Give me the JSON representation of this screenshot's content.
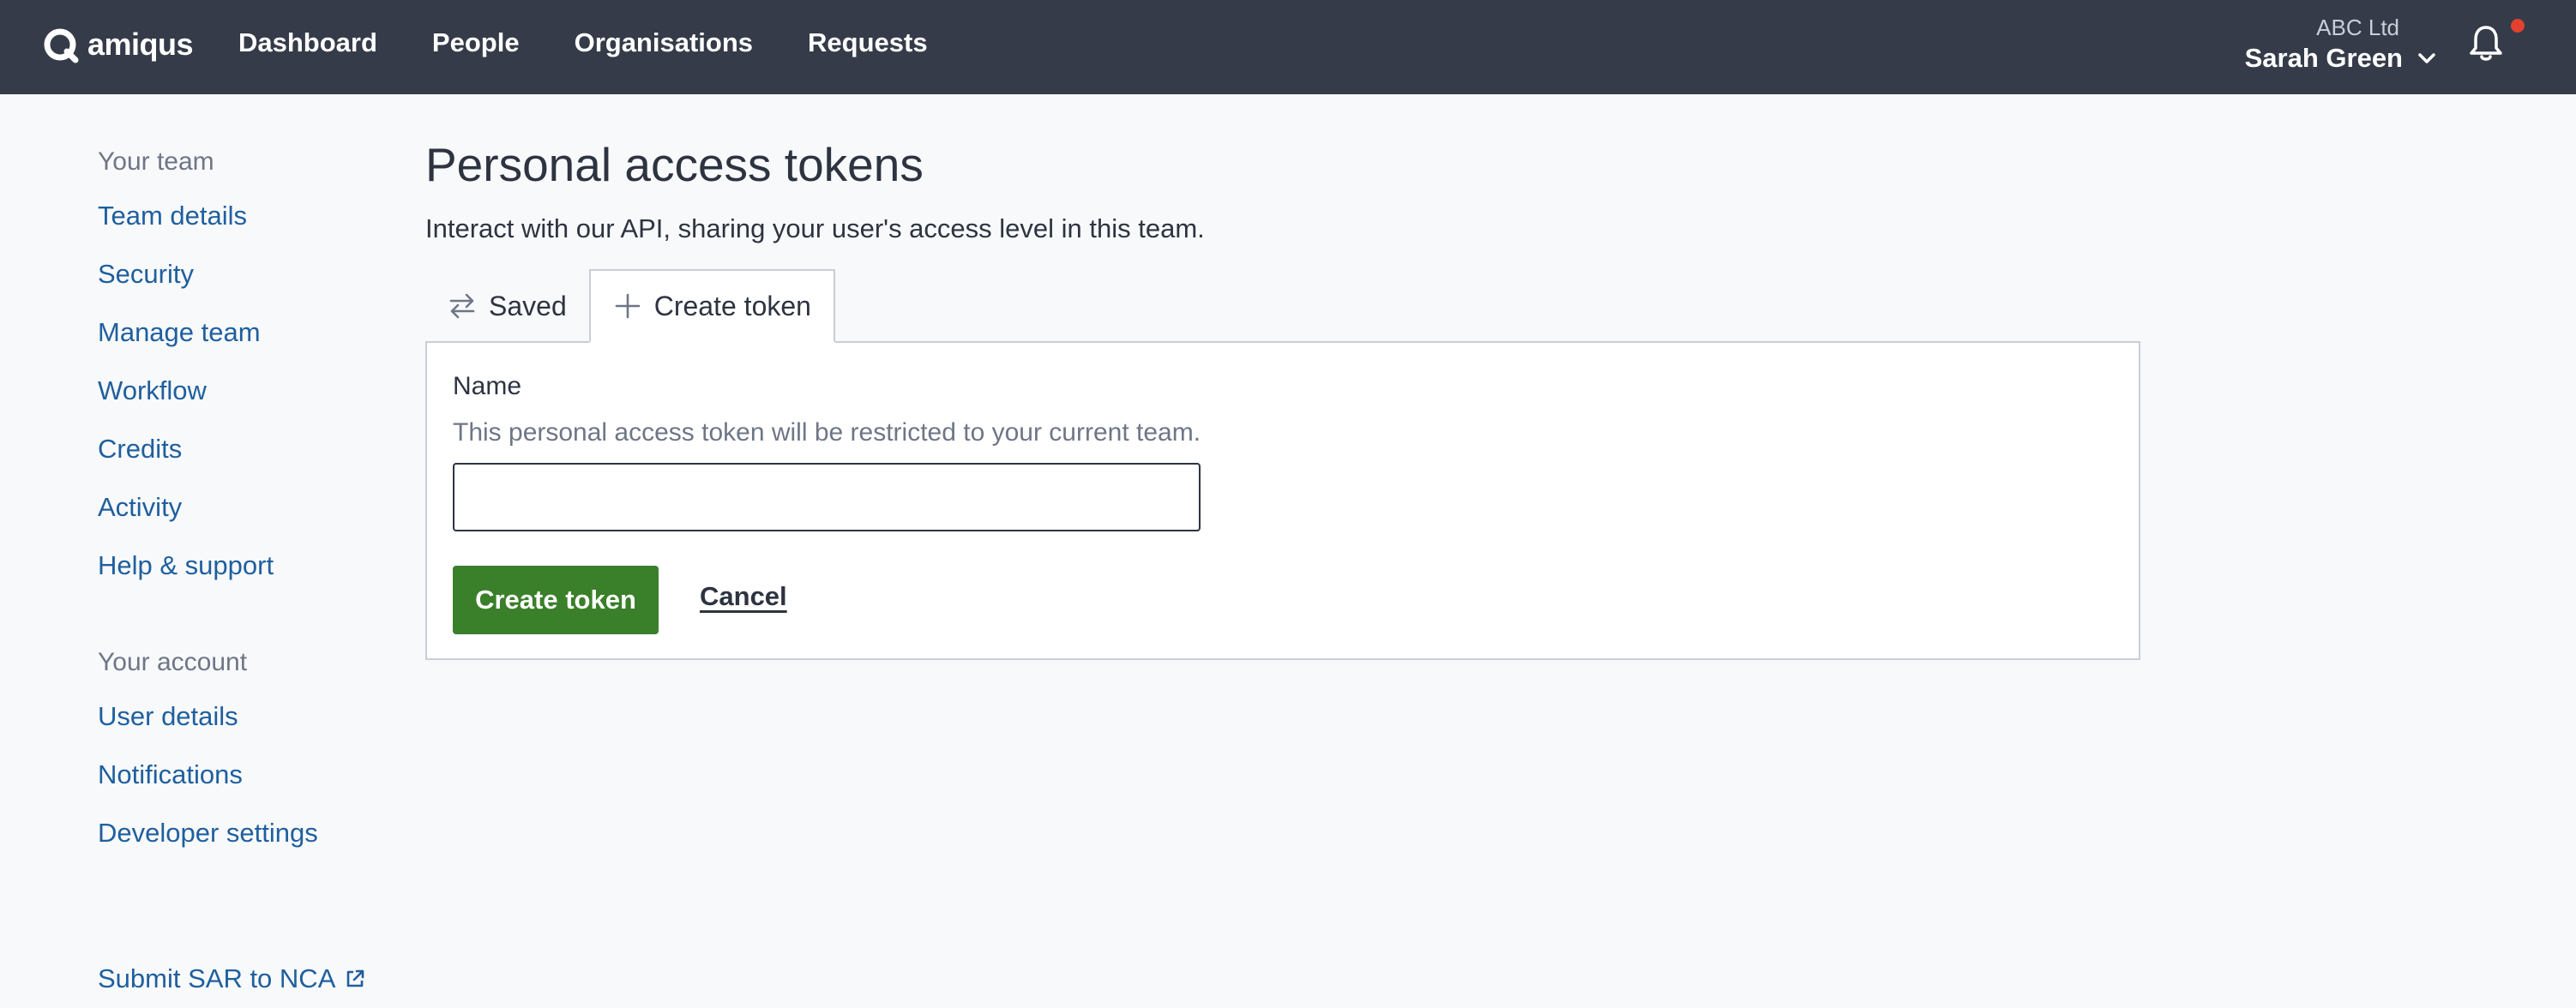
{
  "brand": {
    "name": "amiqus",
    "accent": "#3a7f29",
    "navbar_bg": "#353b48",
    "link_color": "#1f5f9e",
    "notification_color": "#e2412f"
  },
  "nav": {
    "items": [
      {
        "label": "Dashboard"
      },
      {
        "label": "People"
      },
      {
        "label": "Organisations"
      },
      {
        "label": "Requests"
      }
    ]
  },
  "account": {
    "organisation": "ABC Ltd",
    "user": "Sarah Green",
    "menu_icon": "chevron-down-icon",
    "notifications_icon": "bell-icon",
    "has_unread": true
  },
  "sidebar": {
    "team_heading": "Your team",
    "team_links": [
      {
        "label": "Team details"
      },
      {
        "label": "Security"
      },
      {
        "label": "Manage team"
      },
      {
        "label": "Workflow"
      },
      {
        "label": "Credits"
      },
      {
        "label": "Activity"
      },
      {
        "label": "Help & support"
      }
    ],
    "account_heading": "Your account",
    "account_links": [
      {
        "label": "User details"
      },
      {
        "label": "Notifications"
      },
      {
        "label": "Developer settings"
      }
    ],
    "external_link": {
      "label": "Submit SAR to NCA",
      "icon": "external-link-icon"
    }
  },
  "main": {
    "title": "Personal access tokens",
    "description": "Interact with our API, sharing your user's access level in this team.",
    "tabs": [
      {
        "label": "Saved",
        "icon": "swap-arrows-icon",
        "active": false
      },
      {
        "label": "Create token",
        "icon": "plus-icon",
        "active": true
      }
    ],
    "form": {
      "name_label": "Name",
      "name_hint": "This personal access token will be restricted to your current team.",
      "name_value": "",
      "submit_label": "Create token",
      "cancel_label": "Cancel"
    }
  }
}
